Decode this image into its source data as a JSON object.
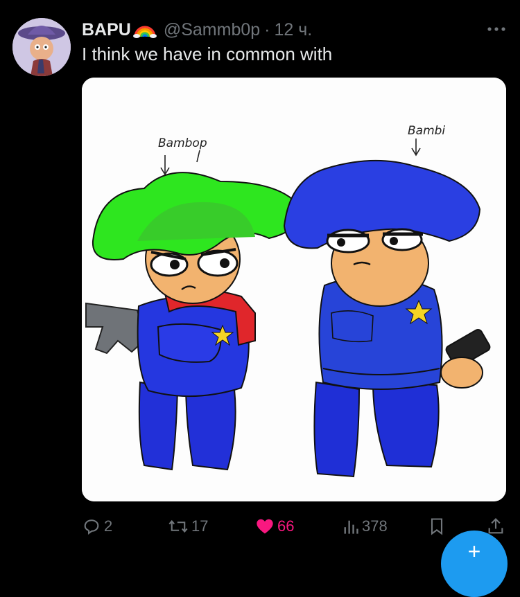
{
  "author": {
    "display_name": "BAPU",
    "badge_icon": "rainbow-emoji-icon",
    "handle": "@Sammb0p",
    "separator": "·",
    "time": "12 ч."
  },
  "tweet": {
    "text": "I think we have in common with"
  },
  "media": {
    "label_left": "Bambop",
    "label_right": "Bambi"
  },
  "actions": {
    "replies": "2",
    "reposts": "17",
    "likes": "66",
    "views": "378"
  },
  "colors": {
    "background": "#000000",
    "text_primary": "#e7e9ea",
    "text_secondary": "#71767b",
    "like_active": "#f91880",
    "accent": "#1d9bf0"
  },
  "icons": {
    "more": "more-horizontal-icon",
    "reply": "reply-bubble-icon",
    "repost": "repost-icon",
    "like": "heart-filled-icon",
    "views": "views-bar-chart-icon",
    "bookmark": "bookmark-icon",
    "share": "share-icon",
    "compose": "compose-plus-icon"
  }
}
